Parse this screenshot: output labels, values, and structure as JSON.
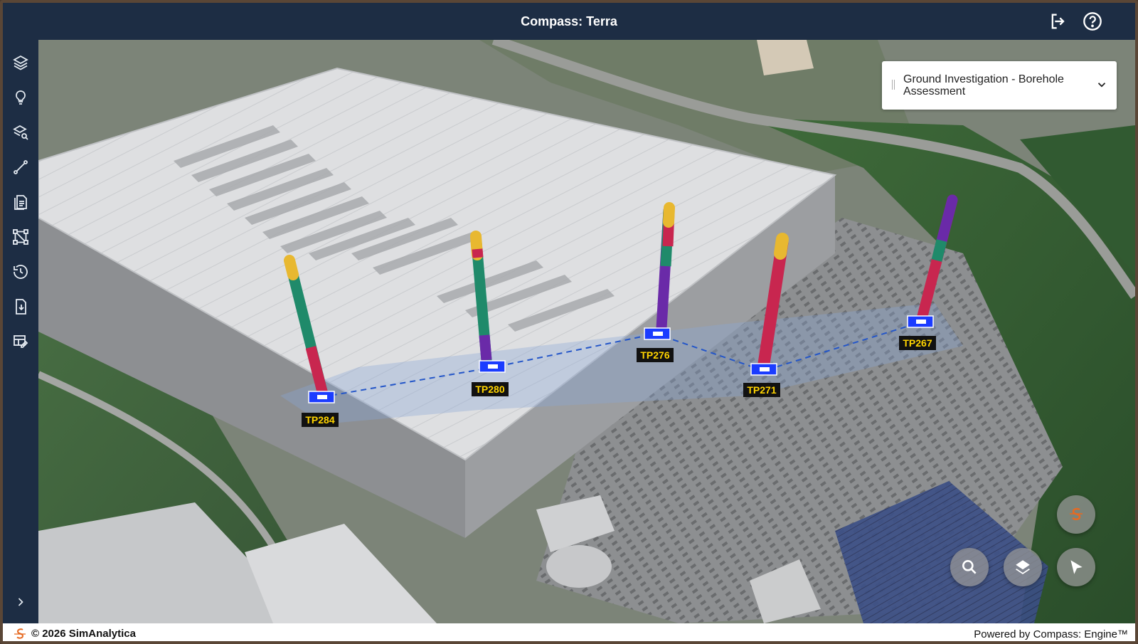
{
  "app": {
    "title": "Compass: Terra"
  },
  "header": {
    "icons": [
      "logout-icon",
      "help-icon"
    ]
  },
  "sidebar": {
    "items": [
      {
        "name": "layers",
        "icon": "layers-icon"
      },
      {
        "name": "insights",
        "icon": "lightbulb-icon"
      },
      {
        "name": "layer-search",
        "icon": "layer-search-icon"
      },
      {
        "name": "measure",
        "icon": "measure-line-icon"
      },
      {
        "name": "reports",
        "icon": "document-list-icon"
      },
      {
        "name": "model",
        "icon": "vector-shape-icon"
      },
      {
        "name": "history",
        "icon": "history-icon"
      },
      {
        "name": "export",
        "icon": "file-export-icon"
      },
      {
        "name": "edit-table",
        "icon": "table-edit-icon"
      }
    ],
    "expand_icon": "chevron-right-icon"
  },
  "dataset": {
    "selected": "Ground Investigation - Borehole Assessment"
  },
  "boreholes": [
    {
      "id": "TP284"
    },
    {
      "id": "TP280"
    },
    {
      "id": "TP276"
    },
    {
      "id": "TP271"
    },
    {
      "id": "TP267"
    }
  ],
  "strata_colors": {
    "topsoil": "#e8b830",
    "clay": "#c8264f",
    "sand": "#1f8a6a",
    "rock": "#6a2aa8"
  },
  "map_controls": {
    "search": "search-icon",
    "layers": "layers-icon",
    "select": "cursor-icon",
    "brand": "simanalytica-logo"
  },
  "footer": {
    "copyright": "© 2026 SimAnalytica",
    "powered_by": "Powered by Compass: Engine™"
  },
  "colors": {
    "chrome": "#1d2d44",
    "label_bg": "#111111",
    "label_text": "#ffd400"
  }
}
